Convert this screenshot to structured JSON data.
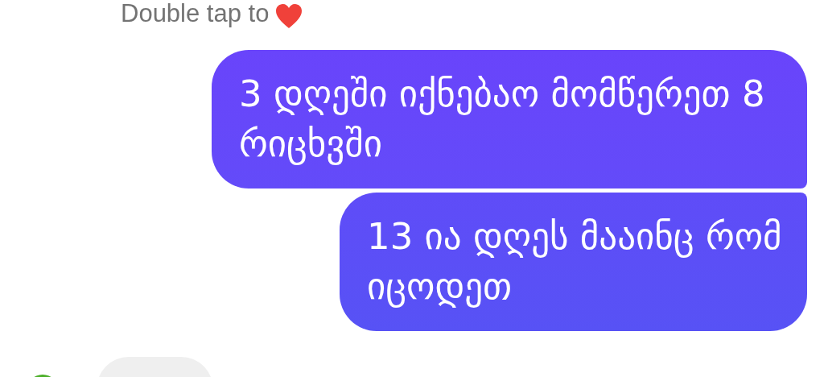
{
  "hint": "Double tap to",
  "messages": [
    {
      "text": "3 დღეში იქნებაო მომწერეთ 8 რიცხვში",
      "outgoing": true
    },
    {
      "text": "13 ია დღეს მააინც რომ იცოდეთ",
      "outgoing": true
    },
    {
      "outgoing": false
    }
  ]
}
